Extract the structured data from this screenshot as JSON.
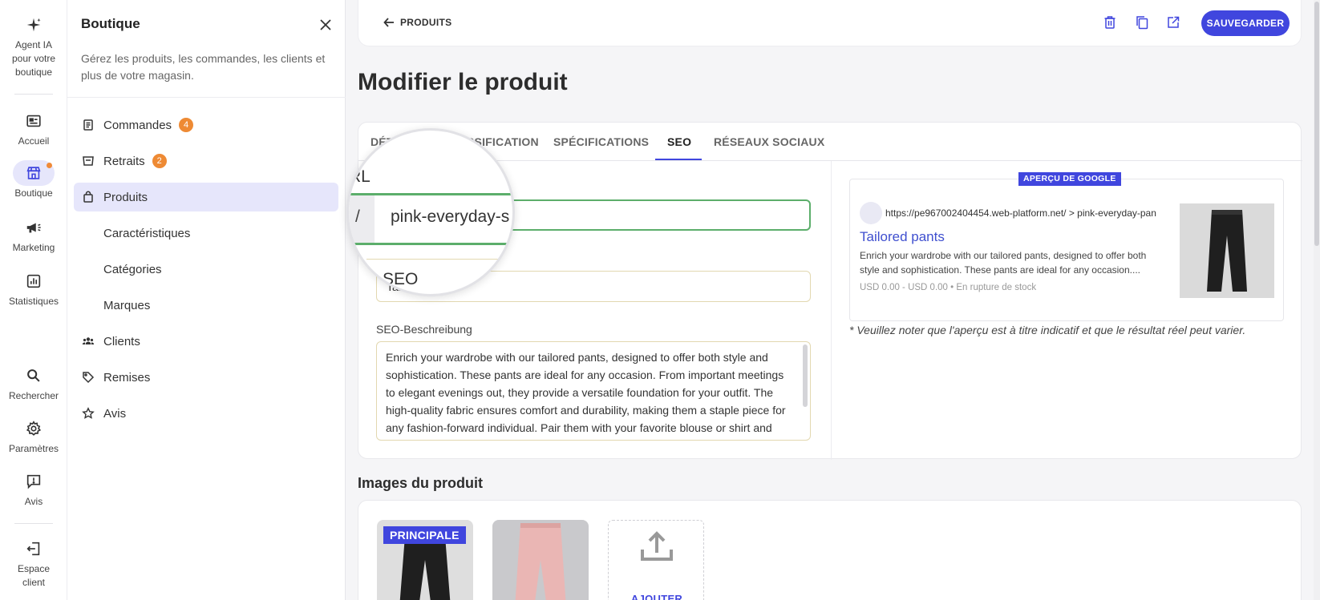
{
  "rail": {
    "items": [
      {
        "label": "Agent IA pour votre boutique",
        "icon": "sparkle-icon"
      },
      {
        "label": "Accueil",
        "icon": "home-icon"
      },
      {
        "label": "Boutique",
        "icon": "store-icon"
      },
      {
        "label": "Marketing",
        "icon": "megaphone-icon"
      },
      {
        "label": "Statistiques",
        "icon": "chart-icon"
      },
      {
        "label": "Rechercher",
        "icon": "search-icon"
      },
      {
        "label": "Paramètres",
        "icon": "gear-icon"
      },
      {
        "label": "Avis",
        "icon": "feedback-icon"
      },
      {
        "label": "Espace client",
        "icon": "logout-icon"
      }
    ]
  },
  "sidebar": {
    "title": "Boutique",
    "description": "Gérez les produits, les commandes, les clients et plus de votre magasin.",
    "items": [
      {
        "label": "Commandes",
        "badge": "4",
        "icon": "receipt-icon"
      },
      {
        "label": "Retraits",
        "badge": "2",
        "icon": "pickup-icon"
      },
      {
        "label": "Produits",
        "icon": "bag-icon"
      },
      {
        "label": "Caractéristiques"
      },
      {
        "label": "Catégories"
      },
      {
        "label": "Marques"
      },
      {
        "label": "Clients",
        "icon": "users-icon"
      },
      {
        "label": "Remises",
        "icon": "tag-icon"
      },
      {
        "label": "Avis",
        "icon": "star-icon"
      }
    ]
  },
  "topbar": {
    "back_label": "PRODUITS",
    "save_label": "SAUVEGARDER"
  },
  "page": {
    "title": "Modifier le produit"
  },
  "tabs": [
    "DÉTAILS",
    "CLASSIFICATION",
    "SPÉCIFICATIONS",
    "SEO",
    "RÉSEAUX SOCIAUX"
  ],
  "tabs_visible": {
    "t0": "DÉTAI",
    "t1": "SSIFICATION",
    "t2": "SPÉCIFICATIONS",
    "t3": "SEO",
    "t4": "RÉSEAUX SOCIAUX"
  },
  "seo": {
    "url_label": "RL",
    "url_prefix": "/",
    "url_value": "pink-everyday-s",
    "title_label": "SEO",
    "title_value": "Tai",
    "desc_label": "SEO-Beschreibung",
    "desc_value": "Enrich your wardrobe with our tailored pants, designed to offer both style and sophistication. These pants are ideal for any occasion. From important meetings to elegant evenings out, they provide a versatile foundation for your outfit. The high-quality fabric ensures comfort and durability, making them a staple piece for any fashion-forward individual. Pair them with your favorite blouse or shirt and step out with confidence. Versatile and setting with the"
  },
  "google_preview": {
    "tag": "APERÇU DE GOOGLE",
    "url": "https://pe967002404454.web-platform.net/ > pink-everyday-pan",
    "title": "Tailored pants",
    "description": "Enrich your wardrobe with our tailored pants, designed to offer both style and sophistication. These pants are ideal for any occasion....",
    "price": "USD 0.00 - USD 0.00 • En rupture de stock",
    "note": "* Veuillez noter que l'aperçu est à titre indicatif et que le résultat réel peut varier."
  },
  "images": {
    "section_title": "Images du produit",
    "principal_tag": "PRINCIPALE",
    "add_label": "AJOUTER"
  },
  "colors": {
    "accent": "#4046de",
    "badge": "#ee8a34",
    "url_field_border": "#5cae6b"
  }
}
